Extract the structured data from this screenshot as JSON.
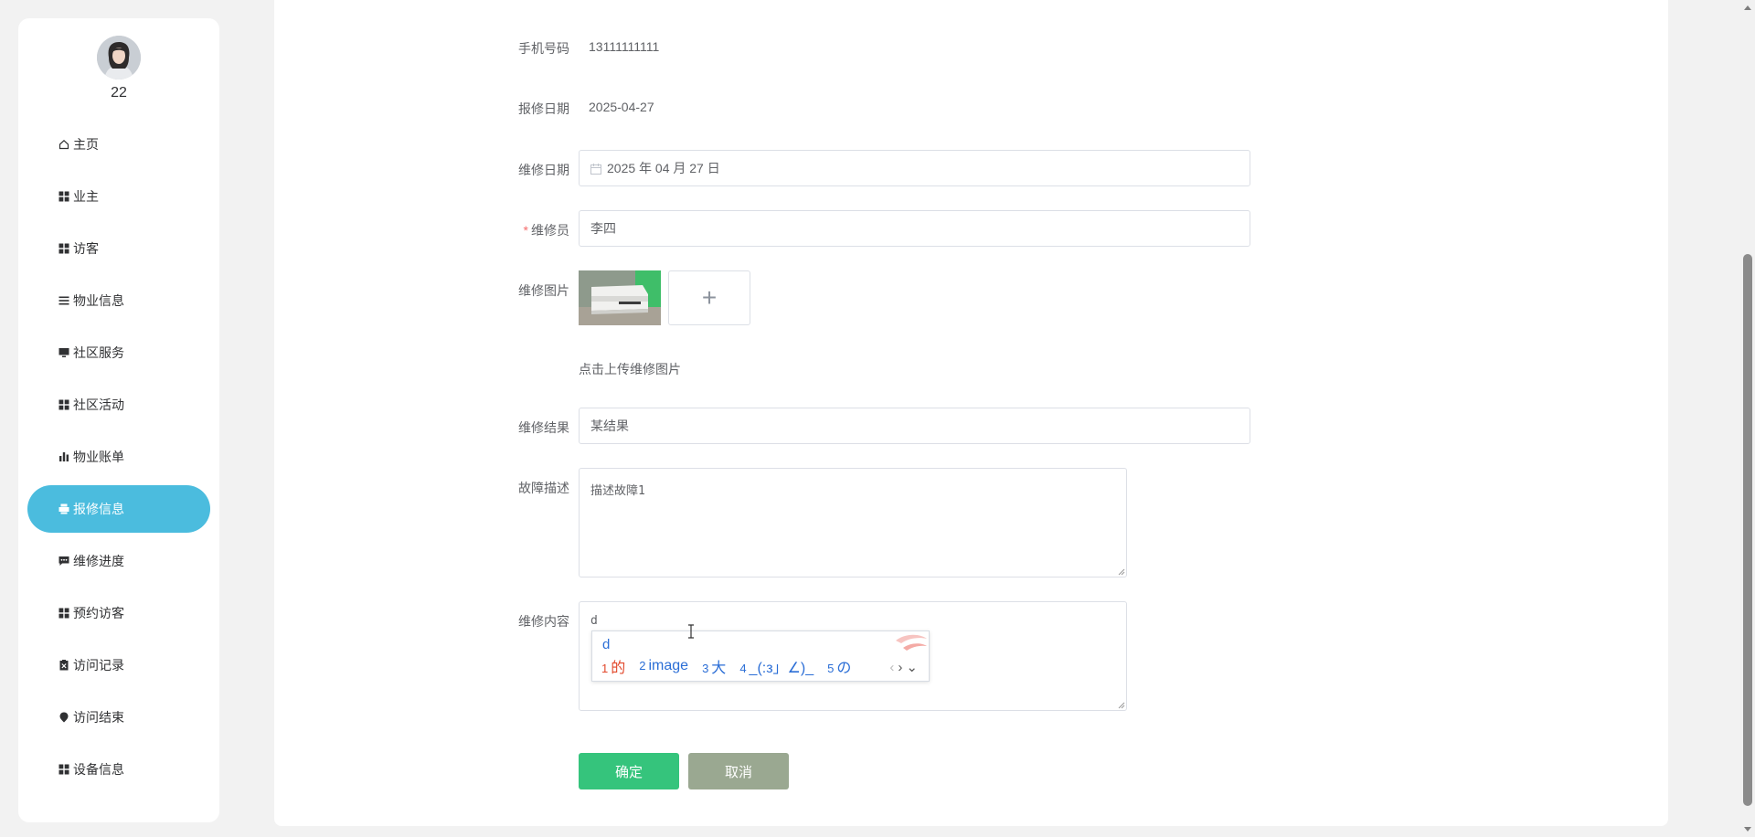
{
  "user": {
    "name": "22",
    "avatar_icon": "user-avatar-photo"
  },
  "sidebar": {
    "items": [
      {
        "label": "主页",
        "icon": "home-icon"
      },
      {
        "label": "业主",
        "icon": "grid-icon"
      },
      {
        "label": "访客",
        "icon": "grid-icon"
      },
      {
        "label": "物业信息",
        "icon": "list-icon"
      },
      {
        "label": "社区服务",
        "icon": "monitor-icon"
      },
      {
        "label": "社区活动",
        "icon": "grid-icon"
      },
      {
        "label": "物业账单",
        "icon": "bar-chart-icon"
      },
      {
        "label": "报修信息",
        "icon": "printer-icon",
        "active": true
      },
      {
        "label": "维修进度",
        "icon": "chat-icon"
      },
      {
        "label": "预约访客",
        "icon": "grid-icon"
      },
      {
        "label": "访问记录",
        "icon": "clipboard-icon"
      },
      {
        "label": "访问结束",
        "icon": "location-pin-icon"
      },
      {
        "label": "设备信息",
        "icon": "grid-icon"
      }
    ],
    "active_color": "#4bbcde"
  },
  "form": {
    "phone": {
      "label": "手机号码",
      "value": "13111111111"
    },
    "report_date": {
      "label": "报修日期",
      "value": "2025-04-27"
    },
    "repair_date": {
      "label": "维修日期",
      "value": "2025 年 04 月 27 日"
    },
    "repairer": {
      "label": "维修员",
      "required_mark": "*",
      "value": "李四"
    },
    "images": {
      "label": "维修图片",
      "add_symbol": "+",
      "hint": "点击上传维修图片"
    },
    "result": {
      "label": "维修结果",
      "value": "某结果"
    },
    "fault": {
      "label": "故障描述",
      "value": "描述故障1"
    },
    "content": {
      "label": "维修内容",
      "value": "d"
    },
    "ime": {
      "composition": "d",
      "candidates": [
        {
          "num": "1",
          "text": "的"
        },
        {
          "num": "2",
          "text": "image"
        },
        {
          "num": "3",
          "text": "大"
        },
        {
          "num": "4",
          "text": "_(:з」∠)_"
        },
        {
          "num": "5",
          "text": "の"
        }
      ],
      "prev_symbol": "‹",
      "next_symbol": "›",
      "expand_symbol": "⌄"
    },
    "buttons": {
      "confirm": "确定",
      "cancel": "取消"
    },
    "colors": {
      "confirm": "#35c47c",
      "cancel": "#9aa891",
      "required": "#f56c6c"
    }
  }
}
